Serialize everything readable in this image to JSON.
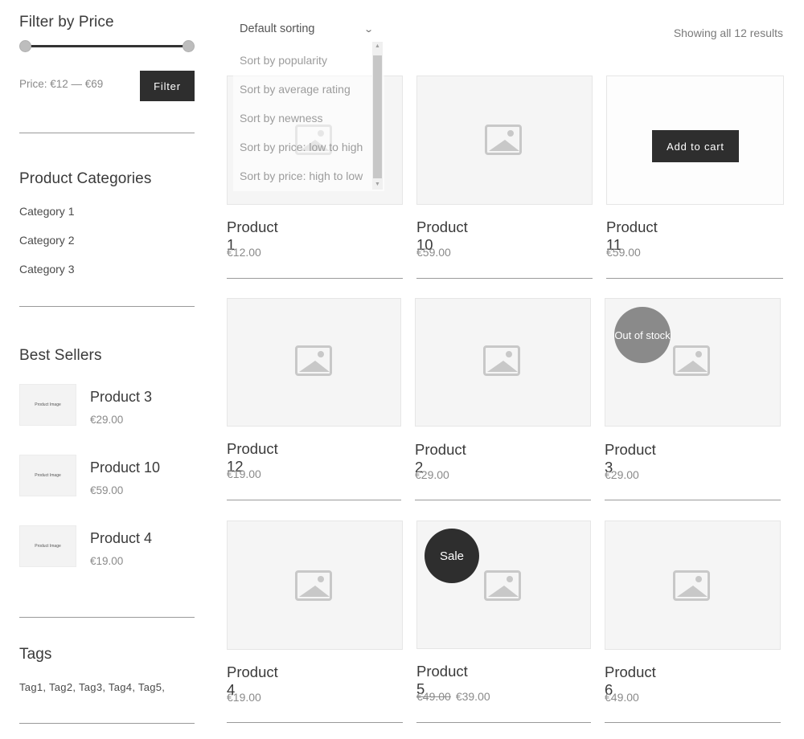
{
  "sidebar": {
    "price_filter": {
      "title": "Filter by Price",
      "price_label": "Price: €12 — €69",
      "button_label": "Filter"
    },
    "categories": {
      "title": "Product Categories",
      "items": [
        "Category 1",
        "Category 2",
        "Category 3"
      ]
    },
    "best_sellers": {
      "title": "Best Sellers",
      "thumb_label": "Product Image",
      "items": [
        {
          "name": "Product 3",
          "price": "€29.00"
        },
        {
          "name": "Product 10",
          "price": "€59.00"
        },
        {
          "name": "Product 4",
          "price": "€19.00"
        }
      ]
    },
    "tags": {
      "title": "Tags",
      "text": "Tag1, Tag2, Tag3, Tag4, Tag5,"
    }
  },
  "toolbar": {
    "sort_selected": "Default sorting",
    "sort_options": [
      "Sort by popularity",
      "Sort by average rating",
      "Sort by newness",
      "Sort by price: low to high",
      "Sort by price: high to low"
    ],
    "result_count": "Showing all 12 results"
  },
  "products": [
    {
      "name": "Product 1",
      "price": "€12.00"
    },
    {
      "name": "Product 10",
      "price": "€59.00"
    },
    {
      "name": "Product 11",
      "price": "€59.00",
      "button": "Add to cart"
    },
    {
      "name": "Product 12",
      "price": "€19.00"
    },
    {
      "name": "Product 2",
      "price": "€29.00"
    },
    {
      "name": "Product 3",
      "price": "€29.00",
      "badge": "Out of stock"
    },
    {
      "name": "Product 4",
      "price": "€19.00"
    },
    {
      "name": "Product 5",
      "old_price": "€49.00",
      "price": "€39.00",
      "badge": "Sale"
    },
    {
      "name": "Product 6",
      "price": "€49.00"
    }
  ],
  "colors": {
    "dark": "#2e2e2e",
    "badge_gray": "#8a8a8a",
    "muted_text": "#8a8a8a",
    "image_bg": "#f5f5f5"
  }
}
